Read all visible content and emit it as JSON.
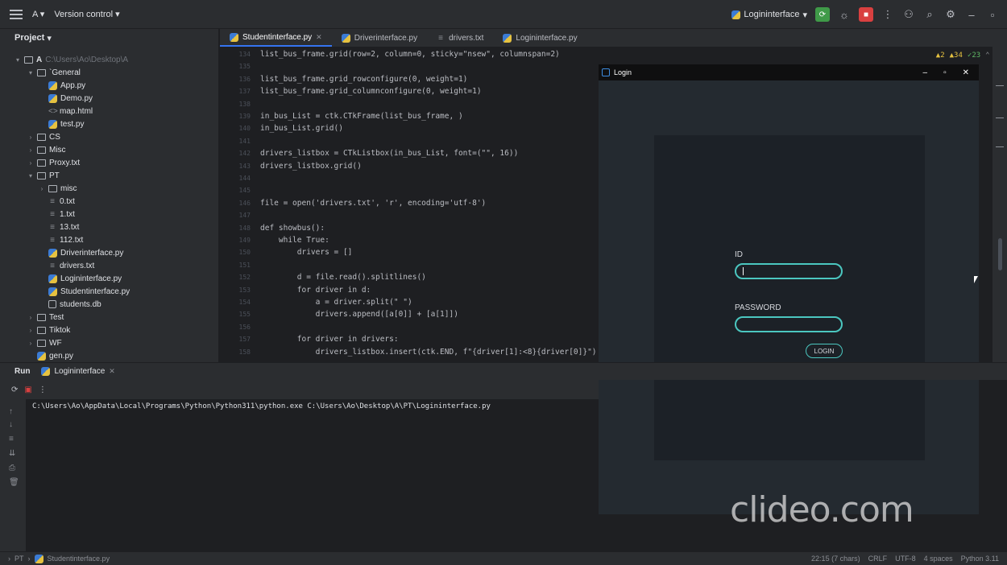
{
  "topbar": {
    "project_name": "A",
    "version_control": "Version control",
    "run_config": "Logininterface"
  },
  "project": {
    "header": "Project",
    "items": [
      {
        "label": "A",
        "path": "C:\\Users\\Ao\\Desktop\\A",
        "type": "folder",
        "open": true
      },
      {
        "label": "`General",
        "type": "folder",
        "open": true
      },
      {
        "label": "App.py",
        "type": "py"
      },
      {
        "label": "Demo.py",
        "type": "py"
      },
      {
        "label": "map.html",
        "type": "html"
      },
      {
        "label": "test.py",
        "type": "py"
      },
      {
        "label": "CS",
        "type": "folder"
      },
      {
        "label": "Misc",
        "type": "folder"
      },
      {
        "label": "Proxy.txt",
        "type": "folder"
      },
      {
        "label": "PT",
        "type": "folder",
        "open": true
      },
      {
        "label": "misc",
        "type": "folder"
      },
      {
        "label": "0.txt",
        "type": "txt"
      },
      {
        "label": "1.txt",
        "type": "txt"
      },
      {
        "label": "13.txt",
        "type": "txt"
      },
      {
        "label": "112.txt",
        "type": "txt"
      },
      {
        "label": "Driverinterface.py",
        "type": "py"
      },
      {
        "label": "drivers.txt",
        "type": "txt"
      },
      {
        "label": "Logininterface.py",
        "type": "py"
      },
      {
        "label": "Studentinterface.py",
        "type": "py"
      },
      {
        "label": "students.db",
        "type": "db"
      },
      {
        "label": "Test",
        "type": "folder"
      },
      {
        "label": "Tiktok",
        "type": "folder"
      },
      {
        "label": "WF",
        "type": "folder"
      },
      {
        "label": "gen.py",
        "type": "py"
      }
    ]
  },
  "tabs": [
    {
      "label": "Studentinterface.py",
      "active": true
    },
    {
      "label": "Driverinterface.py"
    },
    {
      "label": "drivers.txt"
    },
    {
      "label": "Logininterface.py"
    }
  ],
  "inspections": {
    "errors": "2",
    "warnings": "34",
    "ok": "23"
  },
  "code_lines": [
    {
      "n": "134",
      "t": "list_bus_frame.grid(row=2, column=0, sticky=\"nsew\", columnspan=2)"
    },
    {
      "n": "135",
      "t": ""
    },
    {
      "n": "136",
      "t": "list_bus_frame.grid_rowconfigure(0, weight=1)"
    },
    {
      "n": "137",
      "t": "list_bus_frame.grid_columnconfigure(0, weight=1)"
    },
    {
      "n": "138",
      "t": ""
    },
    {
      "n": "139",
      "t": "in_bus_List = ctk.CTkFrame(list_bus_frame, )"
    },
    {
      "n": "140",
      "t": "in_bus_List.grid()"
    },
    {
      "n": "141",
      "t": ""
    },
    {
      "n": "142",
      "t": "drivers_listbox = CTkListbox(in_bus_List, font=(\"\", 16))"
    },
    {
      "n": "143",
      "t": "drivers_listbox.grid()"
    },
    {
      "n": "144",
      "t": ""
    },
    {
      "n": "145",
      "t": ""
    },
    {
      "n": "146",
      "t": "file = open('drivers.txt', 'r', encoding='utf-8')"
    },
    {
      "n": "147",
      "t": ""
    },
    {
      "n": "148",
      "t": "def showbus():"
    },
    {
      "n": "149",
      "t": "    while True:"
    },
    {
      "n": "150",
      "t": "        drivers = []"
    },
    {
      "n": "151",
      "t": ""
    },
    {
      "n": "152",
      "t": "        d = file.read().splitlines()"
    },
    {
      "n": "153",
      "t": "        for driver in d:"
    },
    {
      "n": "154",
      "t": "            a = driver.split(\" \")"
    },
    {
      "n": "155",
      "t": "            drivers.append([a[0]] + [a[1]])"
    },
    {
      "n": "156",
      "t": ""
    },
    {
      "n": "157",
      "t": "        for driver in drivers:"
    },
    {
      "n": "158",
      "t": "            drivers_listbox.insert(ctk.END, f\"{driver[1]:<8}{driver[0]}\")"
    }
  ],
  "login": {
    "window_title": "Login",
    "id_label": "ID",
    "id_value": "",
    "password_label": "PASSWORD",
    "password_value": "",
    "login_button": "LOGIN"
  },
  "run": {
    "label": "Run",
    "tab": "Logininterface",
    "command": "C:\\Users\\Ao\\AppData\\Local\\Programs\\Python\\Python311\\python.exe C:\\Users\\Ao\\Desktop\\A\\PT\\Logininterface.py"
  },
  "status": {
    "crumb_folder": "PT",
    "crumb_file": "Studentinterface.py",
    "position": "22:15 (7 chars)",
    "line_sep": "CRLF",
    "encoding": "UTF-8",
    "indent": "4 spaces",
    "interpreter": "Python 3.11"
  },
  "watermark": "clideo.com",
  "colors": {
    "accent": "#3574f0",
    "login_accent": "#4bc7c0",
    "run_green": "#3f9a48",
    "stop_red": "#d94040"
  }
}
